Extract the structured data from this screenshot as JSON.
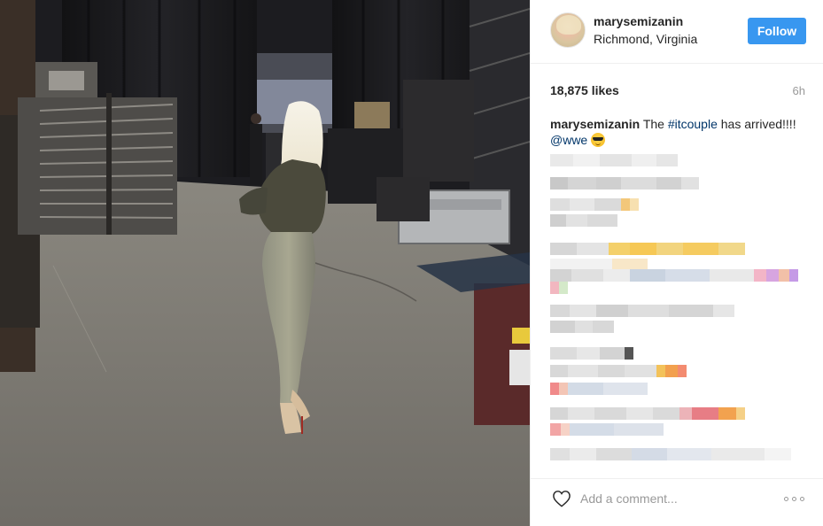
{
  "post": {
    "username": "marysemizanin",
    "location": "Richmond, Virginia",
    "follow_label": "Follow",
    "likes_text": "18,875 likes",
    "time_ago": "6h",
    "caption": {
      "author": "marysemizanin",
      "text_before": "The ",
      "hashtag": "#itcouple",
      "text_after": " has arrived!!!!",
      "mention": "@wwe",
      "emoji": "smiling-face-with-sunglasses"
    },
    "comment_placeholder": "Add a comment..."
  },
  "colors": {
    "accent": "#3897f0",
    "link": "#003569",
    "muted": "#999999",
    "border": "#efefef"
  },
  "icons": {
    "like": "heart-outline-icon",
    "more": "more-options-icon"
  }
}
